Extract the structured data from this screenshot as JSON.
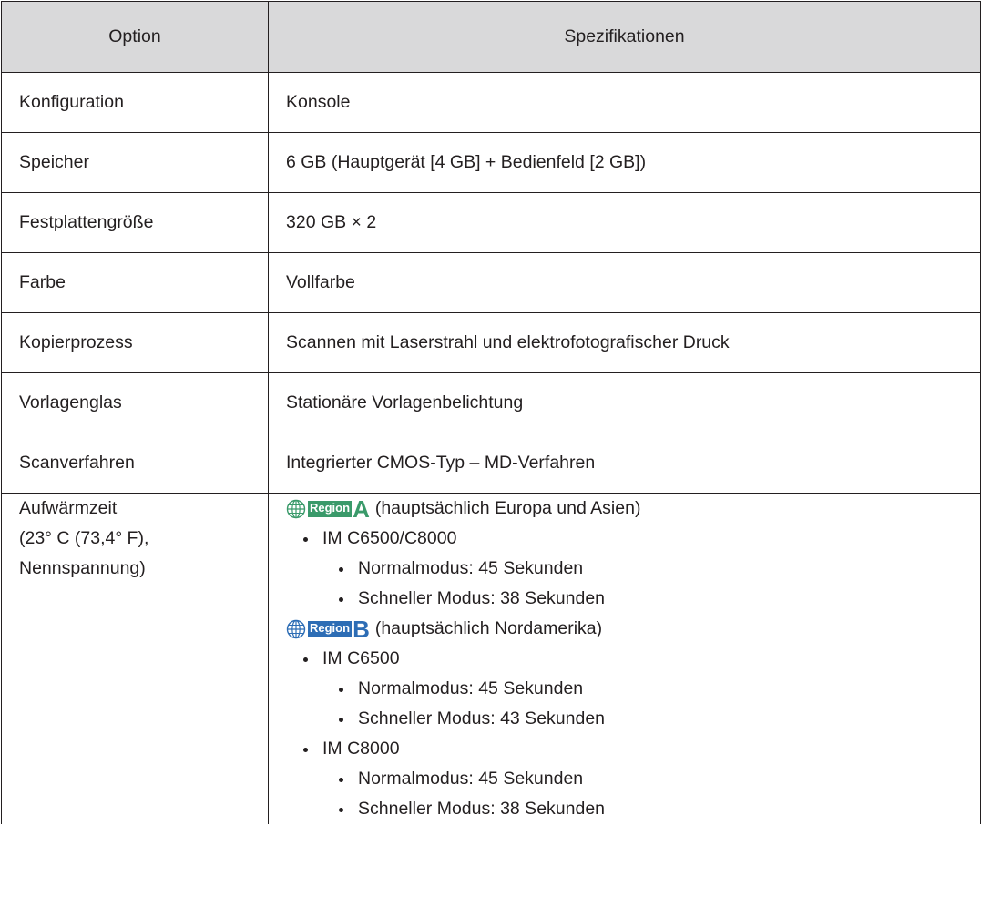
{
  "table": {
    "header": {
      "option": "Option",
      "spec": "Spezifikationen"
    },
    "rows": [
      {
        "label": "Konfiguration",
        "value": "Konsole"
      },
      {
        "label": "Speicher",
        "value": "6 GB (Hauptgerät [4 GB] + Bedienfeld [2 GB])"
      },
      {
        "label": "Festplattengröße",
        "value": "320 GB × 2"
      },
      {
        "label": "Farbe",
        "value": "Vollfarbe"
      },
      {
        "label": "Kopierprozess",
        "value": "Scannen mit Laserstrahl und elektrofotografischer Druck"
      },
      {
        "label": "Vorlagenglas",
        "value": "Stationäre Vorlagenbelichtung"
      },
      {
        "label": "Scanverfahren",
        "value": "Integrierter CMOS-Typ – MD-Verfahren"
      }
    ],
    "warmup": {
      "label_lines": [
        "Aufwärmzeit",
        "(23° C (73,4° F),",
        "Nennspannung)"
      ],
      "region_a": {
        "word": "Region",
        "letter": "A",
        "text": "(hauptsächlich Europa und Asien)",
        "color": "#3a9a6a",
        "models": [
          {
            "name": "IM C6500/C8000",
            "items": [
              "Normalmodus: 45 Sekunden",
              "Schneller Modus: 38 Sekunden"
            ]
          }
        ]
      },
      "region_b": {
        "word": "Region",
        "letter": "B",
        "text": "(hauptsächlich Nordamerika)",
        "color": "#2d6db5",
        "models": [
          {
            "name": "IM C6500",
            "items": [
              "Normalmodus: 45 Sekunden",
              "Schneller Modus: 43 Sekunden"
            ]
          },
          {
            "name": "IM C8000",
            "items": [
              "Normalmodus: 45 Sekunden",
              "Schneller Modus: 38 Sekunden"
            ]
          }
        ]
      }
    }
  },
  "icons": {
    "region": "globe-icon"
  },
  "colors": {
    "header_bg": "#d9d9da",
    "text": "#231f20",
    "border": "#231f20"
  }
}
